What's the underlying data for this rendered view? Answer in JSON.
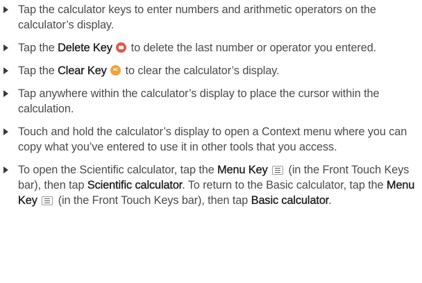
{
  "bullets": [
    {
      "text": "Tap the calculator keys to enter numbers and arithmetic operators on the calculator’s display."
    },
    {
      "pre": "Tap the ",
      "key": "Delete Key",
      "icon": "delete-key-icon",
      "post": " to delete the last number or operator you entered."
    },
    {
      "pre": "Tap the ",
      "key": "Clear Key",
      "icon": "clear-key-icon",
      "post": " to clear the calculator’s display."
    },
    {
      "text": "Tap anywhere within the calculator’s display to place the cursor within the calculation."
    },
    {
      "text": "Touch and hold the calculator’s display to open a Context menu where you can copy what you’ve entered to use it in other tools that you access."
    },
    {
      "p1": "To open the Scientific calculator, tap the ",
      "menu_key": "Menu Key",
      "icon": "menu-key-icon",
      "p2": " (in the Front Touch Keys bar), then tap ",
      "scientific": "Scientific calculator",
      "p3": ". To return to the Basic calculator, tap the ",
      "menu_key_2": "Menu Key",
      "p4": " (in the Front Touch Keys bar), then tap ",
      "basic": "Basic calculator",
      "p5": "."
    }
  ],
  "colors": {
    "text": "#4a4a4a",
    "bold": "#1c1c1c",
    "delete_icon": "#e2584a",
    "clear_icon": "#f3a13a"
  }
}
